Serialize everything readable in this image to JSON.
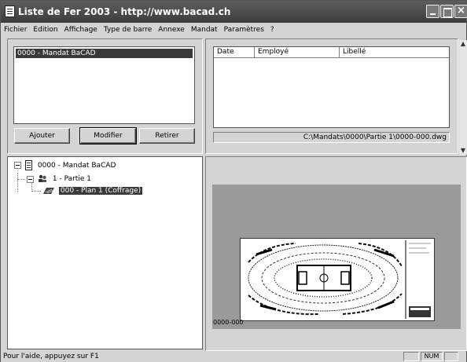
{
  "window": {
    "title": "Liste de Fer 2003 - http://www.bacad.ch"
  },
  "menu": [
    "Fichier",
    "Edition",
    "Affichage",
    "Type de barre",
    "Annexe",
    "Mandat",
    "Paramètres",
    "?"
  ],
  "mandat_list": {
    "selected_item": "0000 - Mandat BaCAD"
  },
  "buttons": {
    "add": "Ajouter",
    "edit": "Modifier",
    "remove": "Retirer"
  },
  "log_table": {
    "columns": [
      "Date",
      "Employé",
      "Libellé"
    ],
    "rows": []
  },
  "path": "C:\\Mandats\\0000\\Partie 1\\0000-000.dwg",
  "tree": {
    "root": "0000 - Mandat BaCAD",
    "part": "1 - Partie 1",
    "plan": "000 - Plan 1 (Coffrage)"
  },
  "preview": {
    "caption": "0000-000"
  },
  "status": {
    "help": "Pour l'aide, appuyez sur F1",
    "num": "NUM"
  }
}
